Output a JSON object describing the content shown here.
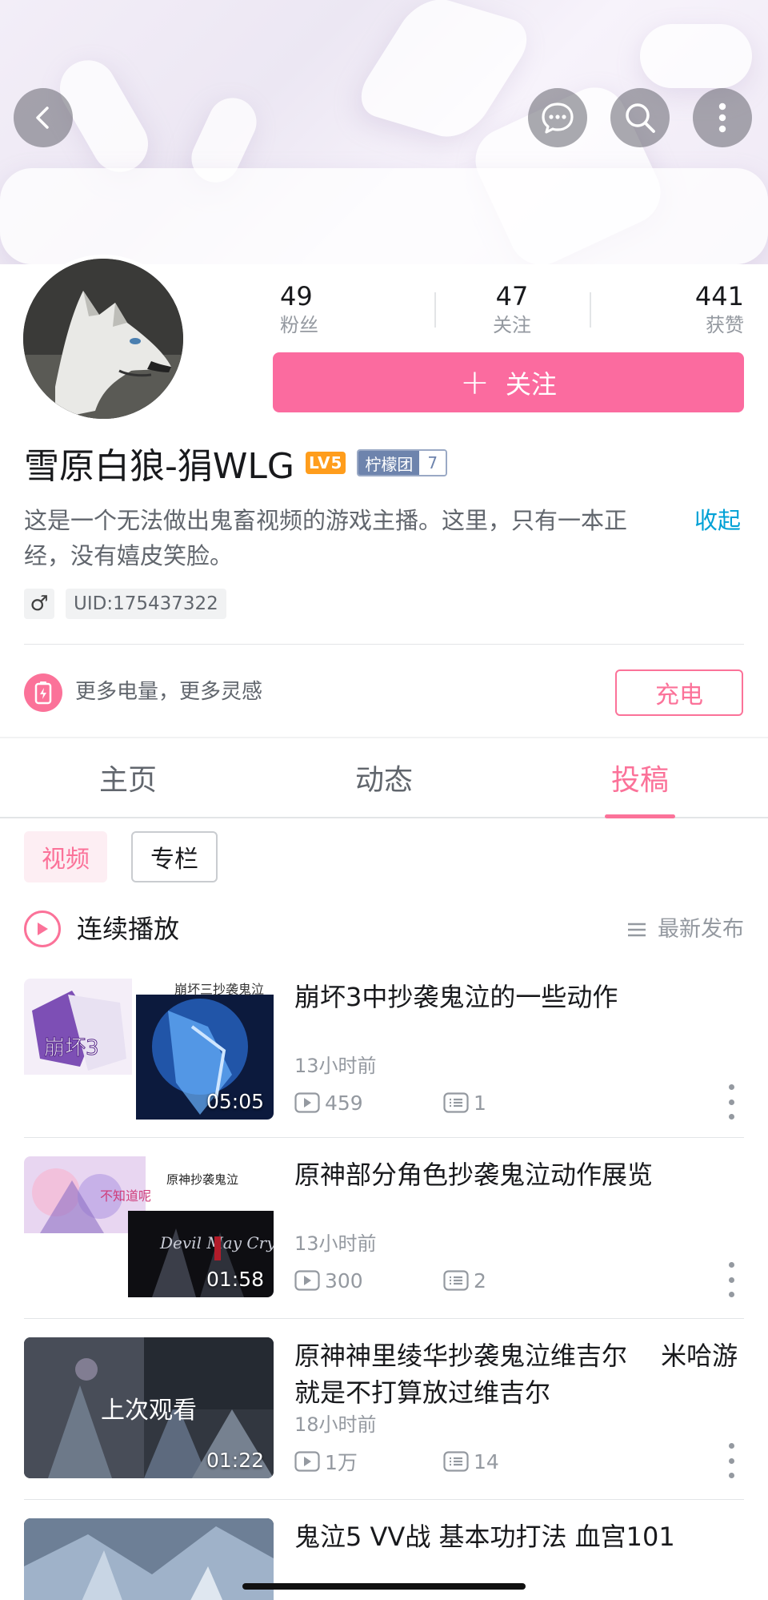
{
  "header": {
    "back_icon": "chevron-left-icon",
    "message_icon": "chat-bubble-icon",
    "search_icon": "search-icon",
    "more_icon": "more-vertical-icon"
  },
  "profile": {
    "stats": [
      {
        "num": "49",
        "label": "粉丝"
      },
      {
        "num": "47",
        "label": "关注"
      },
      {
        "num": "441",
        "label": "获赞"
      }
    ],
    "follow_label": "关注",
    "follow_plus": "+",
    "name": "雪原白狼-狷WLG",
    "level": "LV5",
    "medal_name": "柠檬团",
    "medal_level": "7",
    "bio": "这是一个无法做出鬼畜视频的游戏主播。这里，只有一本正经，没有嬉皮笑脸。",
    "collapse": "收起",
    "gender": "♂",
    "uid": "UID:175437322",
    "charge_text": "更多电量，更多灵感",
    "charge_button": "充电"
  },
  "tabs": [
    "主页",
    "动态",
    "投稿"
  ],
  "subtabs": [
    "视频",
    "专栏"
  ],
  "play_all": "连续播放",
  "sort_label": "最新发布",
  "videos": [
    {
      "title": "崩坏3中抄袭鬼泣的一些动作",
      "time": "13小时前",
      "views": "459",
      "comments": "1",
      "duration": "05:05",
      "thumb_caption": "崩坏三抄袭鬼泣"
    },
    {
      "title": "原神部分角色抄袭鬼泣动作展览",
      "time": "13小时前",
      "views": "300",
      "comments": "2",
      "duration": "01:58",
      "thumb_caption": "原神抄袭鬼泣"
    },
    {
      "title": "原神神里绫华抄袭鬼泣维吉尔　 米哈游就是不打算放过维吉尔",
      "time": "18小时前",
      "views": "1万",
      "comments": "14",
      "duration": "01:22",
      "watched": "上次观看"
    },
    {
      "title": "鬼泣5 VV战 基本功打法 血宫101"
    }
  ],
  "colors": {
    "brand_pink": "#fb7299",
    "follow_pink": "#fb6b9f",
    "link_blue": "#00a1d6",
    "level_orange": "#ff9d1c"
  }
}
